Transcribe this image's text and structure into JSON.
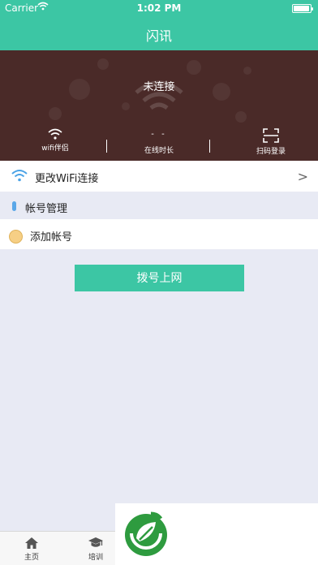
{
  "status_bar": {
    "carrier": "Carrier",
    "time": "1:02 PM"
  },
  "nav": {
    "title": "闪讯"
  },
  "hero": {
    "connection_status": "未连接",
    "wifi_label": "wifi伴侣",
    "online_value": "- -",
    "online_label": "在线时长",
    "scan_label": "扫码登录"
  },
  "change_wifi": {
    "label": "更改WiFi连接",
    "chevron": ">"
  },
  "account_section": {
    "title": "帐号管理"
  },
  "add_account": {
    "label": "添加帐号"
  },
  "dial_button": {
    "label": "拨号上网"
  },
  "tabs": [
    {
      "label": "主页",
      "icon": "home-icon"
    },
    {
      "label": "培训",
      "icon": "graduation-cap-icon"
    }
  ],
  "colors": {
    "accent": "#3cc6a4",
    "hero_bg": "#4a2a28",
    "page_bg": "#e8eaf4"
  }
}
